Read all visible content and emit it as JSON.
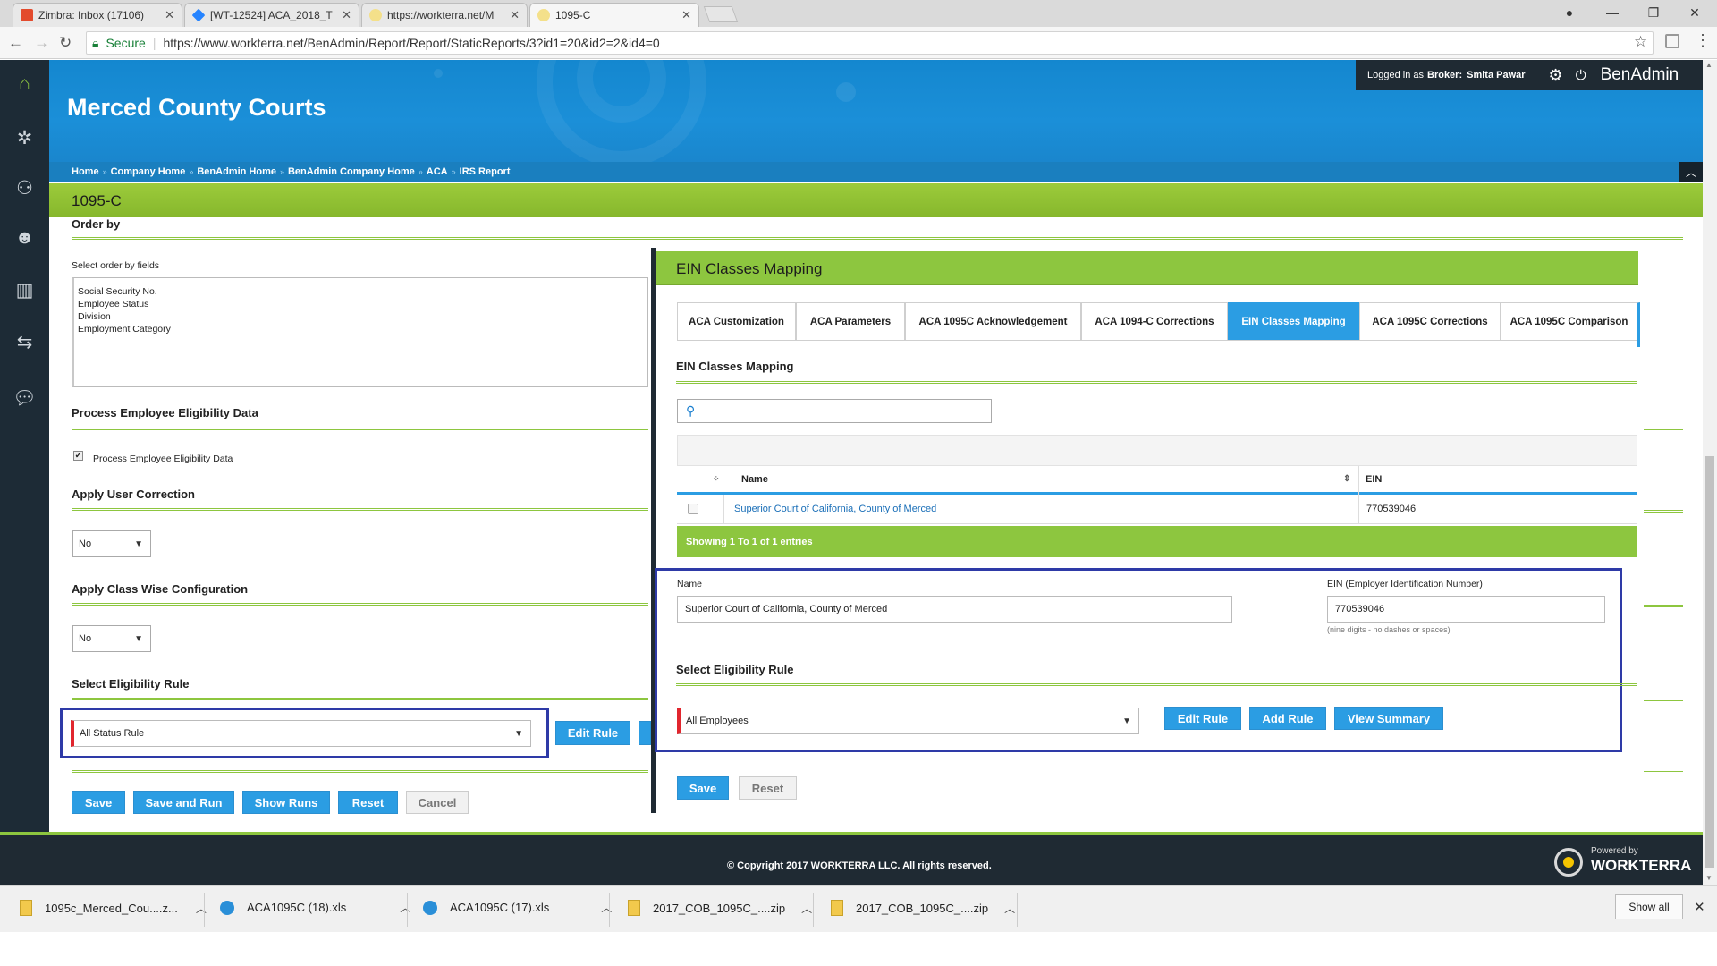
{
  "browser": {
    "tabs": [
      {
        "title": "Zimbra: Inbox (17106)",
        "fav": "#e34b2d"
      },
      {
        "title": "[WT-12524] ACA_2018_T",
        "fav": "#2684ff"
      },
      {
        "title": "https://workterra.net/M",
        "fav": "#c9b11a"
      },
      {
        "title": "1095-C",
        "fav": "#c9b11a"
      }
    ],
    "secure_label": "Secure",
    "url": "https://www.workterra.net/BenAdmin/Report/Report/StaticReports/3?id1=20&id2=2&id4=0"
  },
  "header": {
    "company": "Merced County Courts",
    "logged_in_prefix": "Logged in as",
    "role": "Broker:",
    "user": "Smita Pawar",
    "app": "BenAdmin"
  },
  "breadcrumb": [
    "Home",
    "Company Home",
    "BenAdmin Home",
    "BenAdmin Company Home",
    "ACA",
    "IRS Report"
  ],
  "page_title": "1095-C",
  "left": {
    "order_by_title": "Order by",
    "select_fields_label": "Select order by fields",
    "order_fields": [
      "Social Security No.",
      "Employee Status",
      "Division",
      "Employment Category"
    ],
    "process_title": "Process Employee Eligibility Data",
    "process_checkbox_label": "Process Employee Eligibility Data",
    "user_correction_title": "Apply User Correction",
    "user_correction_value": "No",
    "class_wise_title": "Apply Class Wise Configuration",
    "class_wise_value": "No",
    "eligibility_title": "Select Eligibility Rule",
    "eligibility_value": "All Status Rule",
    "edit_rule": "Edit Rule",
    "buttons": {
      "save": "Save",
      "save_run": "Save and Run",
      "show_runs": "Show Runs",
      "reset": "Reset",
      "cancel": "Cancel"
    }
  },
  "panel": {
    "title": "EIN Classes Mapping",
    "tabs": [
      "ACA Customization",
      "ACA Parameters",
      "ACA 1095C Acknowledgement",
      "ACA 1094-C Corrections",
      "EIN Classes Mapping",
      "ACA 1095C Corrections",
      "ACA 1095C Comparison"
    ],
    "active_tab": "EIN Classes Mapping",
    "section_title": "EIN Classes Mapping",
    "search_placeholder": "",
    "table": {
      "columns": [
        "Name",
        "EIN"
      ],
      "rows": [
        {
          "name": "Superior Court of California, County of Merced",
          "ein": "770539046"
        }
      ],
      "info": "Showing 1 To 1 of 1 entries"
    },
    "form": {
      "name_label": "Name",
      "name_value": "Superior Court of California, County of Merced",
      "ein_label": "EIN (Employer Identification Number)",
      "ein_value": "770539046",
      "ein_hint": "(nine digits - no dashes or spaces)",
      "rule_title": "Select Eligibility Rule",
      "rule_value": "All Employees",
      "edit_rule": "Edit Rule",
      "add_rule": "Add Rule",
      "view_summary": "View Summary"
    },
    "save": "Save",
    "reset": "Reset"
  },
  "footer": {
    "copyright": "© Copyright 2017 WORKTERRA LLC. All rights reserved.",
    "powered_by": "Powered by",
    "brand": "WORKTERRA"
  },
  "downloads": {
    "items": [
      "1095c_Merced_Cou....z...",
      "ACA1095C (18).xls",
      "ACA1095C (17).xls",
      "2017_COB_1095C_....zip",
      "2017_COB_1095C_....zip"
    ],
    "show_all": "Show all"
  }
}
